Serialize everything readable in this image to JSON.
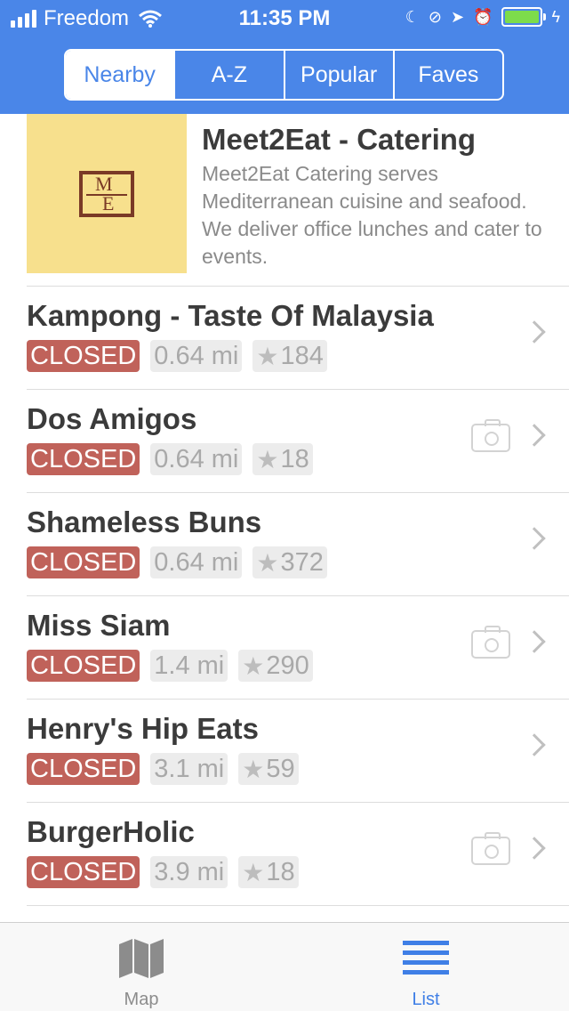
{
  "status_bar": {
    "carrier": "Freedom",
    "time": "11:35 PM",
    "colors": {
      "battery_fill": "#7ddc4b",
      "header_bg": "#4a86e8"
    }
  },
  "segments": [
    {
      "label": "Nearby",
      "active": true
    },
    {
      "label": "A-Z",
      "active": false
    },
    {
      "label": "Popular",
      "active": false
    },
    {
      "label": "Faves",
      "active": false
    }
  ],
  "featured": {
    "title": "Meet2Eat - Catering",
    "description": "Meet2Eat Catering serves Mediterranean cuisine and seafood. We deliver office lunches and cater to events.",
    "logo": {
      "top": "M",
      "bottom": "E"
    }
  },
  "restaurants": [
    {
      "name": "Kampong - Taste Of Malaysia",
      "status": "CLOSED",
      "distance": "0.64 mi",
      "rating": "184",
      "has_photo": false
    },
    {
      "name": "Dos Amigos",
      "status": "CLOSED",
      "distance": "0.64 mi",
      "rating": "18",
      "has_photo": true
    },
    {
      "name": "Shameless Buns",
      "status": "CLOSED",
      "distance": "0.64 mi",
      "rating": "372",
      "has_photo": false
    },
    {
      "name": "Miss Siam",
      "status": "CLOSED",
      "distance": "1.4 mi",
      "rating": "290",
      "has_photo": true
    },
    {
      "name": "Henry's Hip Eats",
      "status": "CLOSED",
      "distance": "3.1 mi",
      "rating": "59",
      "has_photo": false
    },
    {
      "name": "BurgerHolic",
      "status": "CLOSED",
      "distance": "3.9 mi",
      "rating": "18",
      "has_photo": true
    }
  ],
  "colors": {
    "closed_badge": "#c0625a",
    "accent": "#3f7fe6"
  },
  "tabbar": {
    "map_label": "Map",
    "list_label": "List"
  }
}
